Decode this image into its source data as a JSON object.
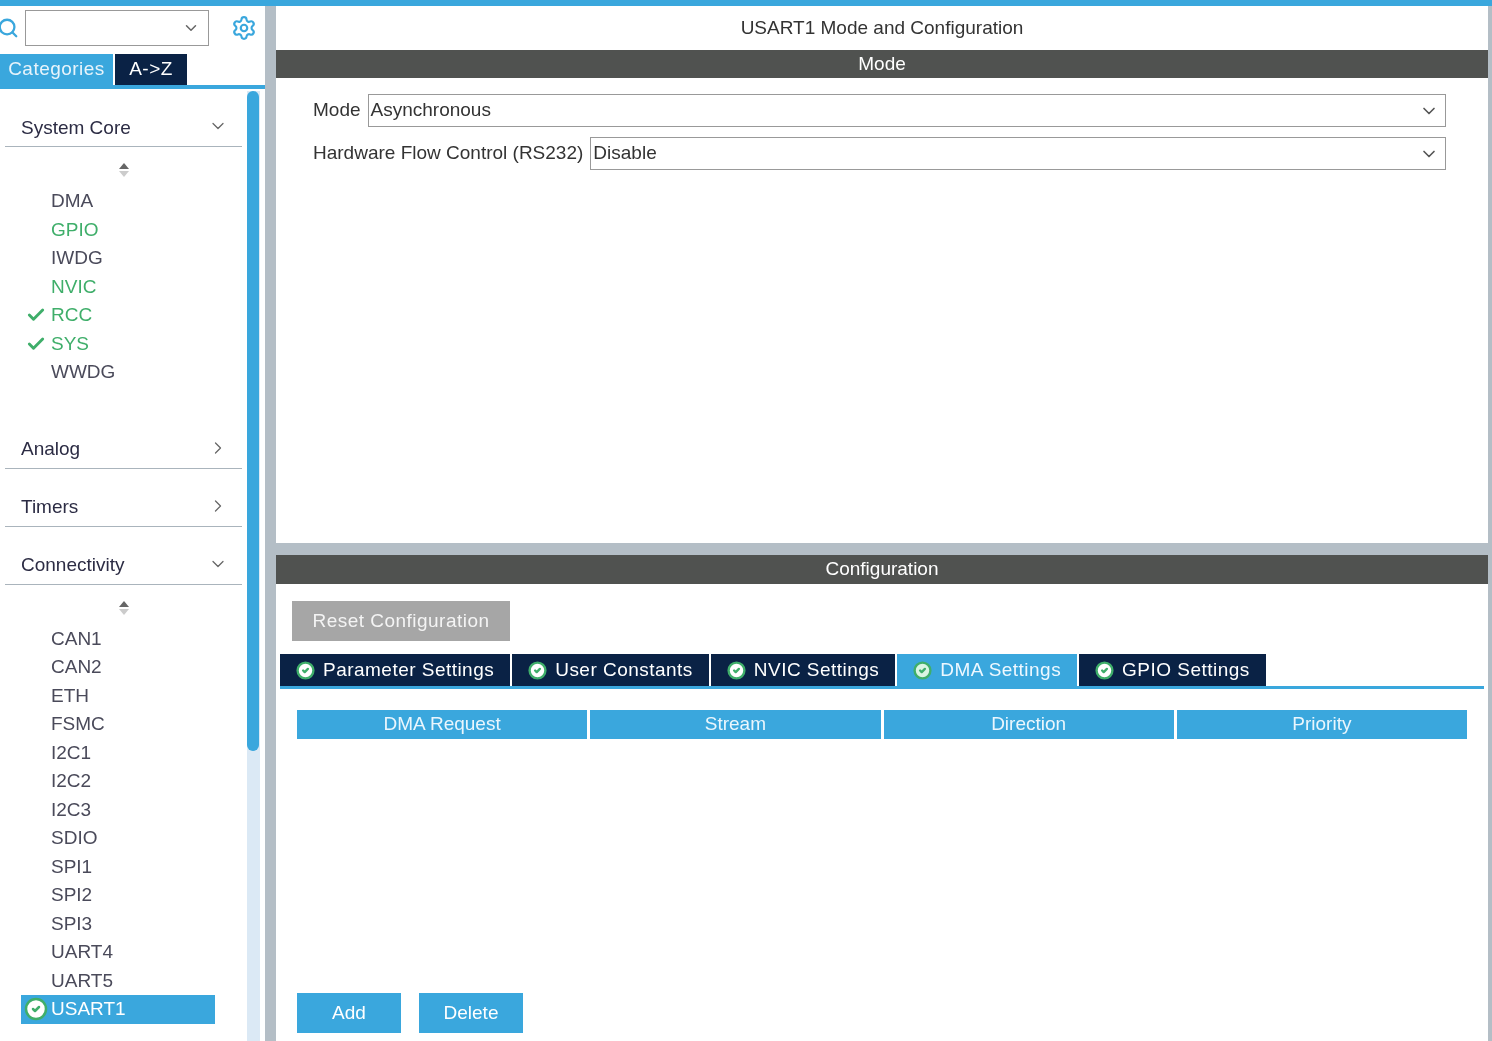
{
  "sidebar": {
    "tabs": [
      {
        "label": "Categories",
        "selected": true
      },
      {
        "label": "A->Z",
        "selected": false
      }
    ],
    "categories": [
      {
        "label": "System Core",
        "expanded": true,
        "items": [
          {
            "label": "DMA",
            "configured": false,
            "checked": false,
            "selected": false
          },
          {
            "label": "GPIO",
            "configured": true,
            "checked": false,
            "selected": false
          },
          {
            "label": "IWDG",
            "configured": false,
            "checked": false,
            "selected": false
          },
          {
            "label": "NVIC",
            "configured": true,
            "checked": false,
            "selected": false
          },
          {
            "label": "RCC",
            "configured": true,
            "checked": true,
            "selected": false
          },
          {
            "label": "SYS",
            "configured": true,
            "checked": true,
            "selected": false
          },
          {
            "label": "WWDG",
            "configured": false,
            "checked": false,
            "selected": false
          }
        ]
      },
      {
        "label": "Analog",
        "expanded": false
      },
      {
        "label": "Timers",
        "expanded": false
      },
      {
        "label": "Connectivity",
        "expanded": true,
        "items": [
          {
            "label": "CAN1",
            "configured": false,
            "checked": false,
            "selected": false
          },
          {
            "label": "CAN2",
            "configured": false,
            "checked": false,
            "selected": false
          },
          {
            "label": "ETH",
            "configured": false,
            "checked": false,
            "selected": false
          },
          {
            "label": "FSMC",
            "configured": false,
            "checked": false,
            "selected": false
          },
          {
            "label": "I2C1",
            "configured": false,
            "checked": false,
            "selected": false
          },
          {
            "label": "I2C2",
            "configured": false,
            "checked": false,
            "selected": false
          },
          {
            "label": "I2C3",
            "configured": false,
            "checked": false,
            "selected": false
          },
          {
            "label": "SDIO",
            "configured": false,
            "checked": false,
            "selected": false
          },
          {
            "label": "SPI1",
            "configured": false,
            "checked": false,
            "selected": false
          },
          {
            "label": "SPI2",
            "configured": false,
            "checked": false,
            "selected": false
          },
          {
            "label": "SPI3",
            "configured": false,
            "checked": false,
            "selected": false
          },
          {
            "label": "UART4",
            "configured": false,
            "checked": false,
            "selected": false
          },
          {
            "label": "UART5",
            "configured": false,
            "checked": false,
            "selected": false
          },
          {
            "label": "USART1",
            "checked": true,
            "selected": true
          }
        ]
      }
    ]
  },
  "main": {
    "title": "USART1 Mode and Configuration",
    "mode": {
      "header": "Mode",
      "fields": [
        {
          "label": "Mode",
          "value": "Asynchronous"
        },
        {
          "label": "Hardware Flow Control (RS232)",
          "value": "Disable"
        }
      ]
    },
    "configuration": {
      "header": "Configuration",
      "reset_button": "Reset Configuration",
      "tabs": [
        {
          "label": "Parameter Settings",
          "selected": false
        },
        {
          "label": "User Constants",
          "selected": false
        },
        {
          "label": "NVIC Settings",
          "selected": false
        },
        {
          "label": "DMA Settings",
          "selected": true
        },
        {
          "label": "GPIO Settings",
          "selected": false
        }
      ],
      "table": {
        "columns": [
          "DMA Request",
          "Stream",
          "Direction",
          "Priority"
        ]
      },
      "buttons": [
        "Add",
        "Delete"
      ]
    }
  }
}
